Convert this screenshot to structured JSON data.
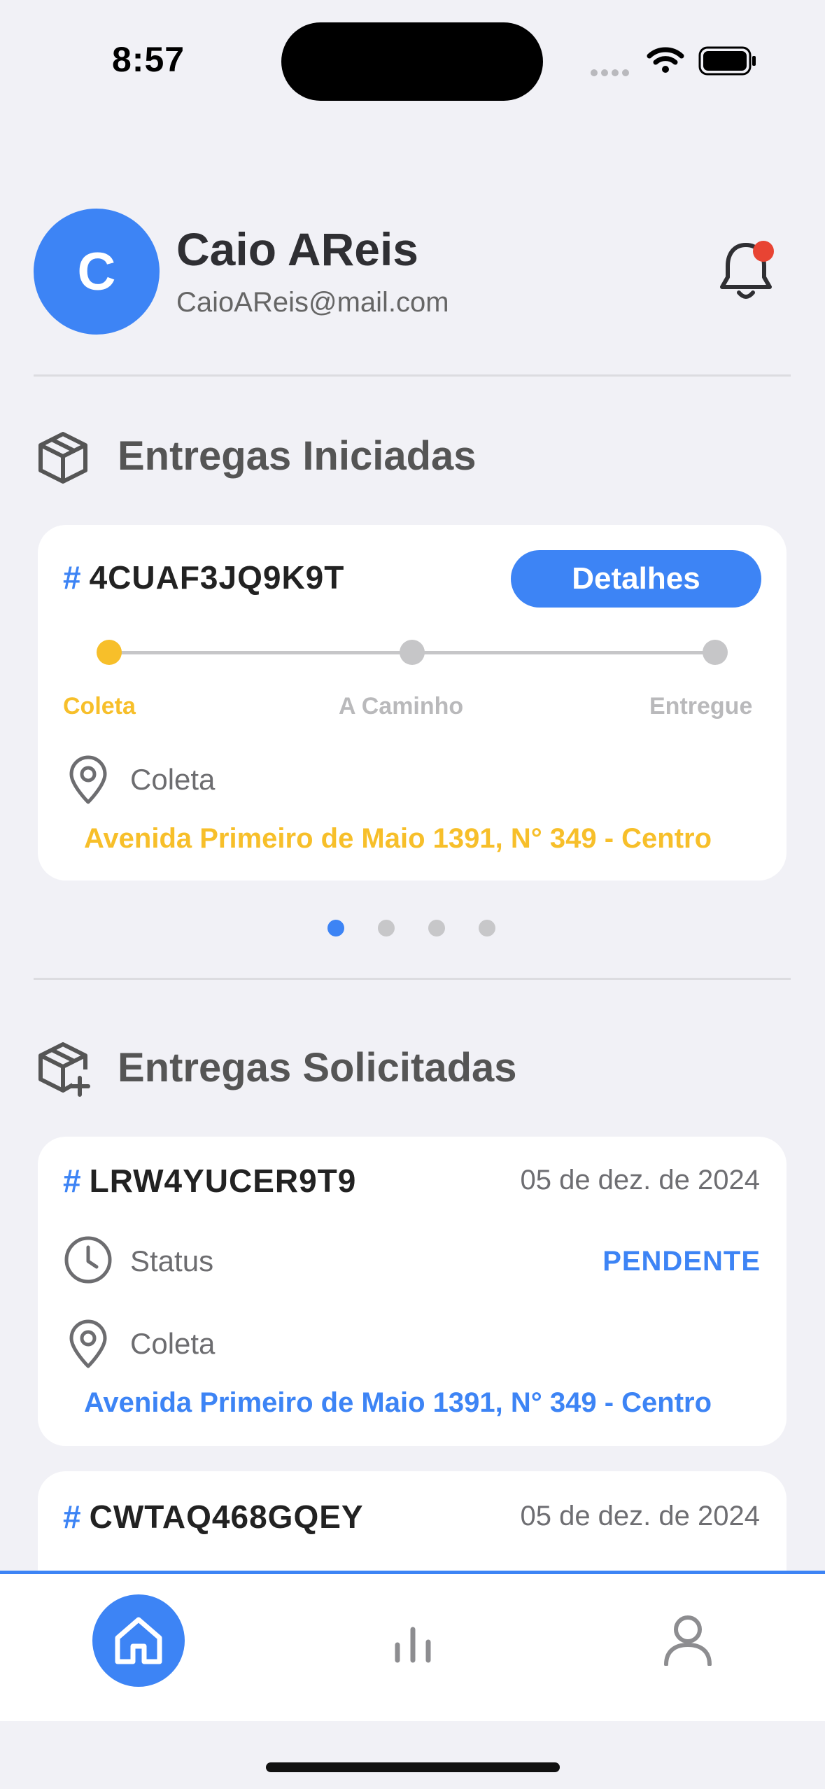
{
  "status_bar": {
    "time": "8:57"
  },
  "header": {
    "avatar_initial": "C",
    "name": "Caio AReis",
    "email": "CaioAReis@mail.com",
    "notification_dot_color": "#e84433"
  },
  "started": {
    "title": "Entregas Iniciadas",
    "card": {
      "hash": "#",
      "code": "4CUAF3JQ9K9T",
      "details_label": "Detalhes",
      "steps": [
        "Coleta",
        "A Caminho",
        "Entregue"
      ],
      "active_step": 0,
      "pickup_label": "Coleta",
      "address": "Avenida Primeiro de Maio 1391, N° 349 - Centro"
    },
    "pager": {
      "count": 4,
      "active": 0
    }
  },
  "requested": {
    "title": "Entregas Solicitadas",
    "cards": [
      {
        "hash": "#",
        "code": "LRW4YUCER9T9",
        "date": "05 de dez. de 2024",
        "status_label": "Status",
        "status_value": "PENDENTE",
        "pickup_label": "Coleta",
        "address": "Avenida Primeiro de Maio 1391, N° 349 - Centro"
      },
      {
        "hash": "#",
        "code": "CWTAQ468GQEY",
        "date": "05 de dez. de 2024"
      }
    ]
  },
  "tabbar": {
    "active_tab": "home",
    "tabs": [
      "home-icon",
      "stats-icon",
      "profile-icon"
    ]
  },
  "colors": {
    "accent": "#3d84f5",
    "active_step": "#f7bf2a",
    "inactive": "#c6c6c8",
    "background": "#f1f1f6"
  }
}
